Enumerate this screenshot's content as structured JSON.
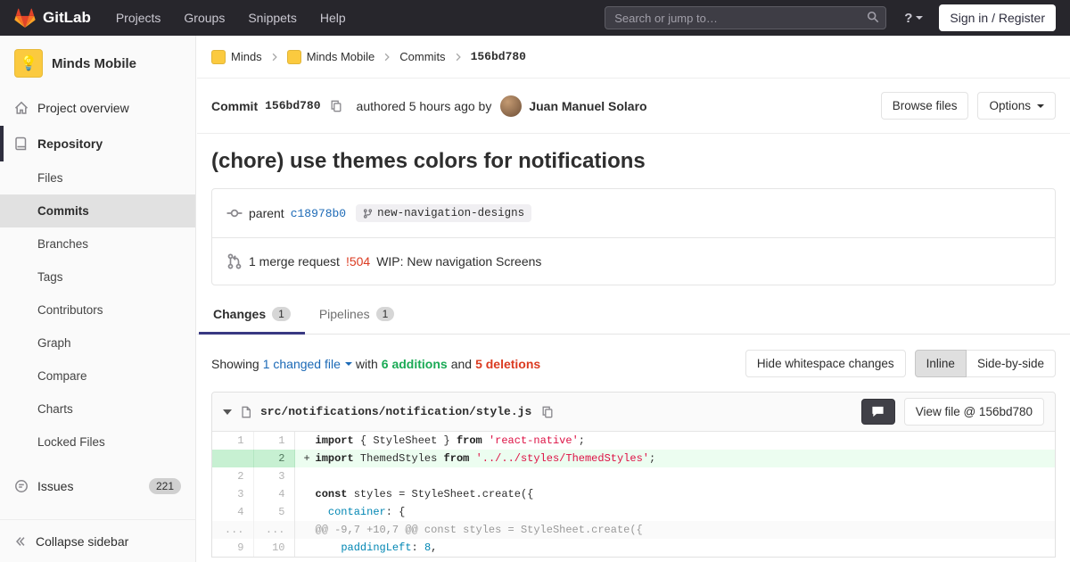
{
  "colors": {
    "navbar_bg": "#27262c",
    "accent_indigo": "#393982",
    "link_blue": "#1b69b6",
    "added_green": "#1aaa55",
    "removed_red": "#db3b21",
    "avatar_yellow": "#fbca3f",
    "brand_orange": "#e24329"
  },
  "navbar": {
    "brand": "GitLab",
    "links": [
      {
        "label": "Projects"
      },
      {
        "label": "Groups"
      },
      {
        "label": "Snippets"
      },
      {
        "label": "Help"
      }
    ],
    "search_placeholder": "Search or jump to…",
    "help_glyph": "?",
    "signin_label": "Sign in / Register"
  },
  "sidebar": {
    "project_name": "Minds Mobile",
    "avatar_emoji": "💡",
    "items": [
      {
        "label": "Project overview"
      },
      {
        "label": "Repository"
      },
      {
        "label": "Issues",
        "badge": "221"
      }
    ],
    "repo_subitems": [
      "Files",
      "Commits",
      "Branches",
      "Tags",
      "Contributors",
      "Graph",
      "Compare",
      "Charts",
      "Locked Files"
    ],
    "collapse_label": "Collapse sidebar"
  },
  "breadcrumb": {
    "items": [
      "Minds",
      "Minds Mobile",
      "Commits"
    ],
    "current": "156bd780"
  },
  "commit": {
    "label": "Commit",
    "sha": "156bd780",
    "authored": "authored 5 hours ago by",
    "author": "Juan Manuel Solaro",
    "browse_files_label": "Browse files",
    "options_label": "Options",
    "title": "(chore) use themes colors for notifications",
    "parent_label": "parent",
    "parent_sha": "c18978b0",
    "branch": "new-navigation-designs",
    "mr_text": "1 merge request",
    "mr_ref": "!504",
    "mr_title": "WIP: New navigation Screens"
  },
  "tabs": [
    {
      "label": "Changes",
      "count": "1"
    },
    {
      "label": "Pipelines",
      "count": "1"
    }
  ],
  "summary": {
    "showing": "Showing",
    "changed_files": "1 changed file",
    "with_word": "with",
    "additions": "6 additions",
    "and_word": "and",
    "deletions": "5 deletions",
    "hide_whitespace_label": "Hide whitespace changes",
    "inline_label": "Inline",
    "side_by_side_label": "Side-by-side"
  },
  "diff": {
    "file_path": "src/notifications/notification/style.js",
    "view_file_label": "View file @ 156bd780",
    "lines": [
      {
        "old": "1",
        "new": "1",
        "type": "ctx",
        "marker": "",
        "segments": [
          {
            "c": "k",
            "t": "import"
          },
          {
            "c": "p",
            "t": " { StyleSheet } "
          },
          {
            "c": "k",
            "t": "from"
          },
          {
            "c": "p",
            "t": " "
          },
          {
            "c": "s",
            "t": "'react-native'"
          },
          {
            "c": "p",
            "t": ";"
          }
        ]
      },
      {
        "old": "",
        "new": "2",
        "type": "add",
        "marker": "+",
        "segments": [
          {
            "c": "k",
            "t": "import"
          },
          {
            "c": "p",
            "t": " ThemedStyles "
          },
          {
            "c": "k",
            "t": "from"
          },
          {
            "c": "p",
            "t": " "
          },
          {
            "c": "s",
            "t": "'../../styles/ThemedStyles'"
          },
          {
            "c": "p",
            "t": ";"
          }
        ]
      },
      {
        "old": "2",
        "new": "3",
        "type": "ctx",
        "marker": "",
        "segments": []
      },
      {
        "old": "3",
        "new": "4",
        "type": "ctx",
        "marker": "",
        "segments": [
          {
            "c": "k",
            "t": "const"
          },
          {
            "c": "p",
            "t": " styles = StyleSheet.create({"
          }
        ]
      },
      {
        "old": "4",
        "new": "5",
        "type": "ctx",
        "marker": "",
        "segments": [
          {
            "c": "p",
            "t": "  "
          },
          {
            "c": "n",
            "t": "container"
          },
          {
            "c": "p",
            "t": ": {"
          }
        ]
      },
      {
        "old": "...",
        "new": "...",
        "type": "hunk",
        "marker": "",
        "segments": [
          {
            "c": "h",
            "t": "@@ -9,7 +10,7 @@ const styles = StyleSheet.create({"
          }
        ]
      },
      {
        "old": "9",
        "new": "10",
        "type": "ctx",
        "marker": "",
        "segments": [
          {
            "c": "p",
            "t": "    "
          },
          {
            "c": "n",
            "t": "paddingLeft"
          },
          {
            "c": "p",
            "t": ": "
          },
          {
            "c": "num",
            "t": "8"
          },
          {
            "c": "p",
            "t": ","
          }
        ]
      }
    ]
  }
}
